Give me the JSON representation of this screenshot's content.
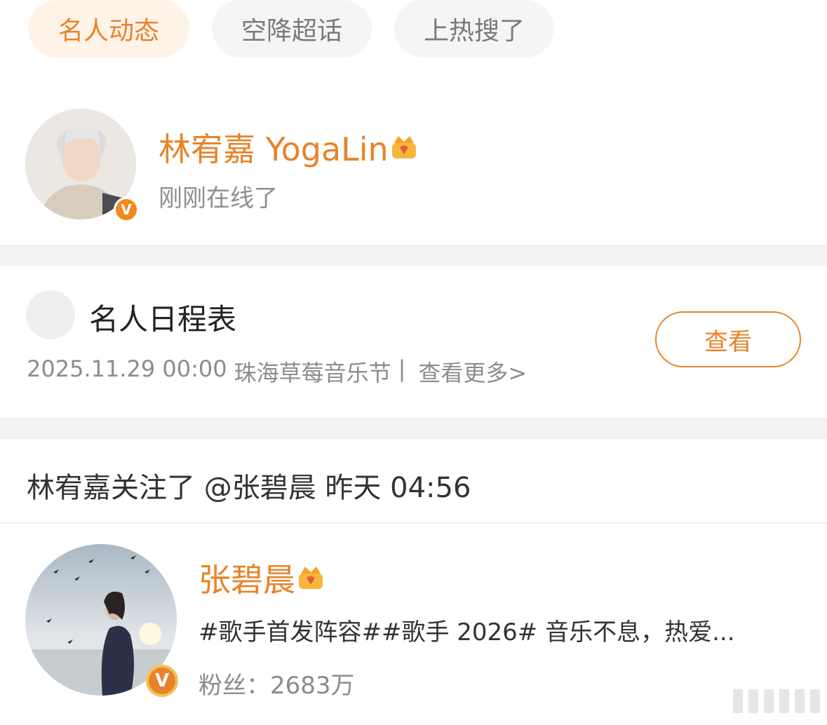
{
  "tabs": [
    {
      "label": "名人动态",
      "active": true
    },
    {
      "label": "空降超话",
      "active": false
    },
    {
      "label": "上热搜了",
      "active": false
    }
  ],
  "celebrity": {
    "name": "林宥嘉 YogaLin",
    "status": "刚刚在线了",
    "verified_badge": "V",
    "crown_icon": "crown-icon"
  },
  "schedule": {
    "title": "名人日程表",
    "date": "2025.11.29 00:00",
    "event": "珠海草莓音乐节",
    "separator": "|",
    "more_link": "查看更多>",
    "view_button": "查看"
  },
  "feed": {
    "action": "林宥嘉关注了 @张碧晨 昨天 04:56",
    "followed_user": {
      "name": "张碧晨",
      "description": "#歌手首发阵容##歌手 2026# 音乐不息，热爱...",
      "fans": "粉丝：2683万",
      "verified_badge": "V"
    }
  },
  "colors": {
    "accent": "#e8832a",
    "tab_active_bg": "#fff3e8",
    "tab_bg": "#f5f5f5",
    "divider": "#f2f2f2",
    "muted_text": "#8c8c8c"
  }
}
